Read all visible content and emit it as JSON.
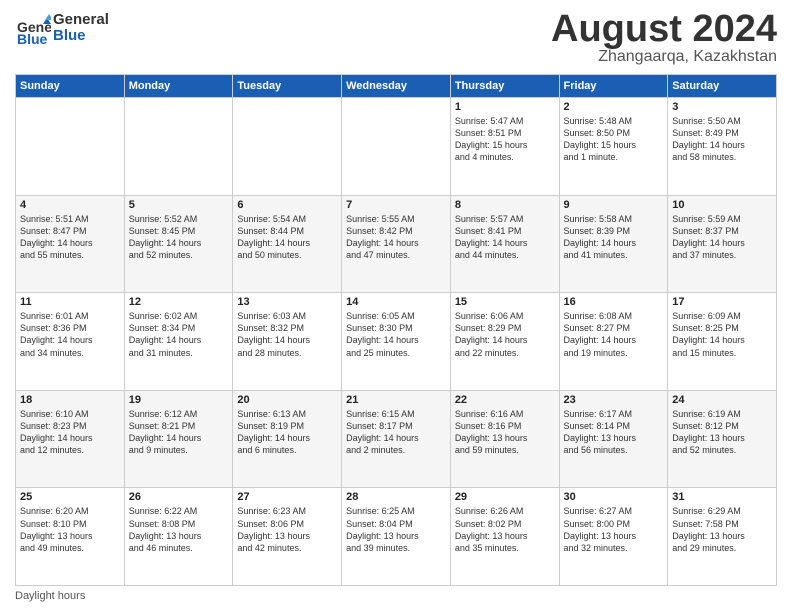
{
  "header": {
    "logo_general": "General",
    "logo_blue": "Blue",
    "main_title": "August 2024",
    "subtitle": "Zhangaarqa, Kazakhstan"
  },
  "calendar": {
    "days_of_week": [
      "Sunday",
      "Monday",
      "Tuesday",
      "Wednesday",
      "Thursday",
      "Friday",
      "Saturday"
    ],
    "weeks": [
      [
        {
          "day": "",
          "info": ""
        },
        {
          "day": "",
          "info": ""
        },
        {
          "day": "",
          "info": ""
        },
        {
          "day": "",
          "info": ""
        },
        {
          "day": "1",
          "info": "Sunrise: 5:47 AM\nSunset: 8:51 PM\nDaylight: 15 hours\nand 4 minutes."
        },
        {
          "day": "2",
          "info": "Sunrise: 5:48 AM\nSunset: 8:50 PM\nDaylight: 15 hours\nand 1 minute."
        },
        {
          "day": "3",
          "info": "Sunrise: 5:50 AM\nSunset: 8:49 PM\nDaylight: 14 hours\nand 58 minutes."
        }
      ],
      [
        {
          "day": "4",
          "info": "Sunrise: 5:51 AM\nSunset: 8:47 PM\nDaylight: 14 hours\nand 55 minutes."
        },
        {
          "day": "5",
          "info": "Sunrise: 5:52 AM\nSunset: 8:45 PM\nDaylight: 14 hours\nand 52 minutes."
        },
        {
          "day": "6",
          "info": "Sunrise: 5:54 AM\nSunset: 8:44 PM\nDaylight: 14 hours\nand 50 minutes."
        },
        {
          "day": "7",
          "info": "Sunrise: 5:55 AM\nSunset: 8:42 PM\nDaylight: 14 hours\nand 47 minutes."
        },
        {
          "day": "8",
          "info": "Sunrise: 5:57 AM\nSunset: 8:41 PM\nDaylight: 14 hours\nand 44 minutes."
        },
        {
          "day": "9",
          "info": "Sunrise: 5:58 AM\nSunset: 8:39 PM\nDaylight: 14 hours\nand 41 minutes."
        },
        {
          "day": "10",
          "info": "Sunrise: 5:59 AM\nSunset: 8:37 PM\nDaylight: 14 hours\nand 37 minutes."
        }
      ],
      [
        {
          "day": "11",
          "info": "Sunrise: 6:01 AM\nSunset: 8:36 PM\nDaylight: 14 hours\nand 34 minutes."
        },
        {
          "day": "12",
          "info": "Sunrise: 6:02 AM\nSunset: 8:34 PM\nDaylight: 14 hours\nand 31 minutes."
        },
        {
          "day": "13",
          "info": "Sunrise: 6:03 AM\nSunset: 8:32 PM\nDaylight: 14 hours\nand 28 minutes."
        },
        {
          "day": "14",
          "info": "Sunrise: 6:05 AM\nSunset: 8:30 PM\nDaylight: 14 hours\nand 25 minutes."
        },
        {
          "day": "15",
          "info": "Sunrise: 6:06 AM\nSunset: 8:29 PM\nDaylight: 14 hours\nand 22 minutes."
        },
        {
          "day": "16",
          "info": "Sunrise: 6:08 AM\nSunset: 8:27 PM\nDaylight: 14 hours\nand 19 minutes."
        },
        {
          "day": "17",
          "info": "Sunrise: 6:09 AM\nSunset: 8:25 PM\nDaylight: 14 hours\nand 15 minutes."
        }
      ],
      [
        {
          "day": "18",
          "info": "Sunrise: 6:10 AM\nSunset: 8:23 PM\nDaylight: 14 hours\nand 12 minutes."
        },
        {
          "day": "19",
          "info": "Sunrise: 6:12 AM\nSunset: 8:21 PM\nDaylight: 14 hours\nand 9 minutes."
        },
        {
          "day": "20",
          "info": "Sunrise: 6:13 AM\nSunset: 8:19 PM\nDaylight: 14 hours\nand 6 minutes."
        },
        {
          "day": "21",
          "info": "Sunrise: 6:15 AM\nSunset: 8:17 PM\nDaylight: 14 hours\nand 2 minutes."
        },
        {
          "day": "22",
          "info": "Sunrise: 6:16 AM\nSunset: 8:16 PM\nDaylight: 13 hours\nand 59 minutes."
        },
        {
          "day": "23",
          "info": "Sunrise: 6:17 AM\nSunset: 8:14 PM\nDaylight: 13 hours\nand 56 minutes."
        },
        {
          "day": "24",
          "info": "Sunrise: 6:19 AM\nSunset: 8:12 PM\nDaylight: 13 hours\nand 52 minutes."
        }
      ],
      [
        {
          "day": "25",
          "info": "Sunrise: 6:20 AM\nSunset: 8:10 PM\nDaylight: 13 hours\nand 49 minutes."
        },
        {
          "day": "26",
          "info": "Sunrise: 6:22 AM\nSunset: 8:08 PM\nDaylight: 13 hours\nand 46 minutes."
        },
        {
          "day": "27",
          "info": "Sunrise: 6:23 AM\nSunset: 8:06 PM\nDaylight: 13 hours\nand 42 minutes."
        },
        {
          "day": "28",
          "info": "Sunrise: 6:25 AM\nSunset: 8:04 PM\nDaylight: 13 hours\nand 39 minutes."
        },
        {
          "day": "29",
          "info": "Sunrise: 6:26 AM\nSunset: 8:02 PM\nDaylight: 13 hours\nand 35 minutes."
        },
        {
          "day": "30",
          "info": "Sunrise: 6:27 AM\nSunset: 8:00 PM\nDaylight: 13 hours\nand 32 minutes."
        },
        {
          "day": "31",
          "info": "Sunrise: 6:29 AM\nSunset: 7:58 PM\nDaylight: 13 hours\nand 29 minutes."
        }
      ]
    ]
  },
  "footer": {
    "text": "Daylight hours"
  }
}
